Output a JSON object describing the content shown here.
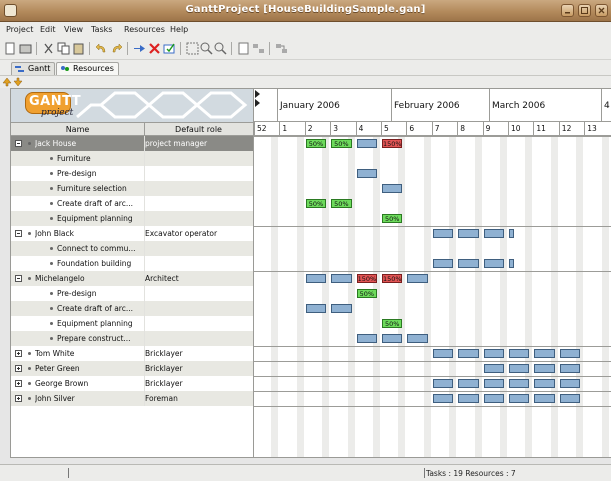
{
  "window": {
    "title": "GanttProject [HouseBuildingSample.gan]"
  },
  "menubar": {
    "items": [
      "Project",
      "Edit",
      "View",
      "Tasks",
      "Resources",
      "Help"
    ]
  },
  "tabs": [
    {
      "label": "Gantt",
      "active": false
    },
    {
      "label": "Resources",
      "active": true
    }
  ],
  "logo": {
    "text": "GANTT",
    "subtext": "project"
  },
  "tree": {
    "columns": {
      "name": "Name",
      "role": "Default role"
    },
    "rows": [
      {
        "name": "Jack House",
        "role": "project manager",
        "level": 0,
        "expander": "minus",
        "selected": true
      },
      {
        "name": "Furniture",
        "role": "",
        "level": 1
      },
      {
        "name": "Pre-design",
        "role": "",
        "level": 1
      },
      {
        "name": "Furniture selection",
        "role": "",
        "level": 1
      },
      {
        "name": "Create draft of arc...",
        "role": "",
        "level": 1
      },
      {
        "name": "Equipment planning",
        "role": "",
        "level": 1
      },
      {
        "name": "John Black",
        "role": "Excavator operator",
        "level": 0,
        "expander": "minus"
      },
      {
        "name": "Connect to commu...",
        "role": "",
        "level": 1
      },
      {
        "name": "Foundation building",
        "role": "",
        "level": 1
      },
      {
        "name": "Michelangelo",
        "role": "Architect",
        "level": 0,
        "expander": "minus"
      },
      {
        "name": "Pre-design",
        "role": "",
        "level": 1
      },
      {
        "name": "Create draft of arc...",
        "role": "",
        "level": 1
      },
      {
        "name": "Equipment planning",
        "role": "",
        "level": 1
      },
      {
        "name": "Prepare construct...",
        "role": "",
        "level": 1
      },
      {
        "name": "Tom White",
        "role": "Bricklayer",
        "level": 0,
        "expander": "plus"
      },
      {
        "name": "Peter Green",
        "role": "Bricklayer",
        "level": 0,
        "expander": "plus"
      },
      {
        "name": "George Brown",
        "role": "Bricklayer",
        "level": 0,
        "expander": "plus"
      },
      {
        "name": "John Silver",
        "role": "Foreman",
        "level": 0,
        "expander": "plus"
      }
    ]
  },
  "chart": {
    "months": [
      "January 2006",
      "February 2006",
      "March 2006",
      "4"
    ],
    "weeks": [
      "52",
      "1",
      "2",
      "3",
      "4",
      "5",
      "6",
      "7",
      "8",
      "9",
      "10",
      "11",
      "12",
      "13"
    ],
    "bars": [
      {
        "row": 0,
        "week": 2,
        "span": 1,
        "color": "green",
        "label": "50%"
      },
      {
        "row": 0,
        "week": 3,
        "span": 1,
        "color": "green",
        "label": "50%"
      },
      {
        "row": 0,
        "week": 4,
        "span": 1,
        "color": "blue",
        "label": ""
      },
      {
        "row": 0,
        "week": 5,
        "span": 1,
        "color": "red",
        "label": "150%"
      },
      {
        "row": 2,
        "week": 4,
        "span": 1,
        "color": "blue",
        "label": ""
      },
      {
        "row": 3,
        "week": 5,
        "span": 1,
        "color": "blue",
        "label": ""
      },
      {
        "row": 4,
        "week": 2,
        "span": 1,
        "color": "green",
        "label": "50%"
      },
      {
        "row": 4,
        "week": 3,
        "span": 1,
        "color": "green",
        "label": "50%"
      },
      {
        "row": 5,
        "week": 5,
        "span": 1,
        "color": "green",
        "label": "50%"
      },
      {
        "row": 6,
        "week": 7,
        "span": 1,
        "color": "blue",
        "label": ""
      },
      {
        "row": 6,
        "week": 8,
        "span": 1,
        "color": "blue",
        "label": ""
      },
      {
        "row": 6,
        "week": 9,
        "span": 1,
        "color": "blue",
        "label": ""
      },
      {
        "row": 6,
        "week": 10,
        "span": 0.4,
        "color": "blue",
        "label": ""
      },
      {
        "row": 8,
        "week": 7,
        "span": 1,
        "color": "blue",
        "label": ""
      },
      {
        "row": 8,
        "week": 8,
        "span": 1,
        "color": "blue",
        "label": ""
      },
      {
        "row": 8,
        "week": 9,
        "span": 1,
        "color": "blue",
        "label": ""
      },
      {
        "row": 8,
        "week": 10,
        "span": 0.4,
        "color": "blue",
        "label": ""
      },
      {
        "row": 9,
        "week": 2,
        "span": 1,
        "color": "blue",
        "label": ""
      },
      {
        "row": 9,
        "week": 3,
        "span": 1,
        "color": "blue",
        "label": ""
      },
      {
        "row": 9,
        "week": 4,
        "span": 1,
        "color": "red",
        "label": "150%"
      },
      {
        "row": 9,
        "week": 5,
        "span": 1,
        "color": "red",
        "label": "150%"
      },
      {
        "row": 9,
        "week": 6,
        "span": 1,
        "color": "blue",
        "label": ""
      },
      {
        "row": 10,
        "week": 4,
        "span": 1,
        "color": "green",
        "label": "50%"
      },
      {
        "row": 11,
        "week": 2,
        "span": 1,
        "color": "blue",
        "label": ""
      },
      {
        "row": 11,
        "week": 3,
        "span": 1,
        "color": "blue",
        "label": ""
      },
      {
        "row": 12,
        "week": 5,
        "span": 1,
        "color": "green",
        "label": "50%"
      },
      {
        "row": 13,
        "week": 4,
        "span": 1,
        "color": "blue",
        "label": ""
      },
      {
        "row": 13,
        "week": 5,
        "span": 1,
        "color": "blue",
        "label": ""
      },
      {
        "row": 13,
        "week": 6,
        "span": 1,
        "color": "blue",
        "label": ""
      },
      {
        "row": 14,
        "week": 7,
        "span": 1,
        "color": "blue",
        "label": ""
      },
      {
        "row": 14,
        "week": 8,
        "span": 1,
        "color": "blue",
        "label": ""
      },
      {
        "row": 14,
        "week": 9,
        "span": 1,
        "color": "blue",
        "label": ""
      },
      {
        "row": 14,
        "week": 10,
        "span": 1,
        "color": "blue",
        "label": ""
      },
      {
        "row": 14,
        "week": 11,
        "span": 1,
        "color": "blue",
        "label": ""
      },
      {
        "row": 14,
        "week": 12,
        "span": 1,
        "color": "blue",
        "label": ""
      },
      {
        "row": 15,
        "week": 9,
        "span": 1,
        "color": "blue",
        "label": ""
      },
      {
        "row": 15,
        "week": 10,
        "span": 1,
        "color": "blue",
        "label": ""
      },
      {
        "row": 15,
        "week": 11,
        "span": 1,
        "color": "blue",
        "label": ""
      },
      {
        "row": 15,
        "week": 12,
        "span": 1,
        "color": "blue",
        "label": ""
      },
      {
        "row": 16,
        "week": 7,
        "span": 1,
        "color": "blue",
        "label": ""
      },
      {
        "row": 16,
        "week": 8,
        "span": 1,
        "color": "blue",
        "label": ""
      },
      {
        "row": 16,
        "week": 9,
        "span": 1,
        "color": "blue",
        "label": ""
      },
      {
        "row": 16,
        "week": 10,
        "span": 1,
        "color": "blue",
        "label": ""
      },
      {
        "row": 16,
        "week": 11,
        "span": 1,
        "color": "blue",
        "label": ""
      },
      {
        "row": 16,
        "week": 12,
        "span": 1,
        "color": "blue",
        "label": ""
      },
      {
        "row": 17,
        "week": 7,
        "span": 1,
        "color": "blue",
        "label": ""
      },
      {
        "row": 17,
        "week": 8,
        "span": 1,
        "color": "blue",
        "label": ""
      },
      {
        "row": 17,
        "week": 9,
        "span": 1,
        "color": "blue",
        "label": ""
      },
      {
        "row": 17,
        "week": 10,
        "span": 1,
        "color": "blue",
        "label": ""
      },
      {
        "row": 17,
        "week": 11,
        "span": 1,
        "color": "blue",
        "label": ""
      },
      {
        "row": 17,
        "week": 12,
        "span": 1,
        "color": "blue",
        "label": ""
      }
    ]
  },
  "statusbar": {
    "text": "Tasks : 19  Resources : 7"
  },
  "colors": {
    "titlebar": "#b38a5c",
    "bar_normal": "#8fb1d2",
    "bar_over": "#e25454",
    "bar_under": "#6ddb5c",
    "selected_row": "#8a8a86"
  }
}
